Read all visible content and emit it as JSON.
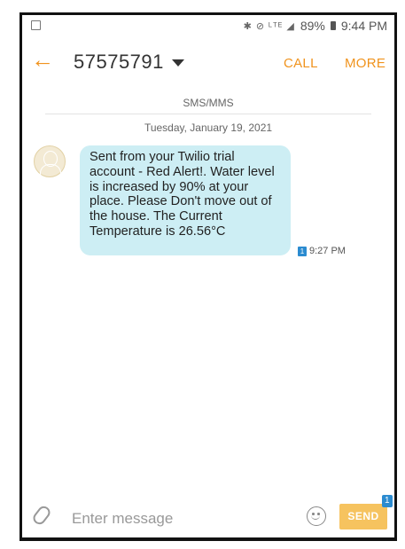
{
  "status": {
    "battery": "89%",
    "time": "9:44 PM",
    "icons": [
      "screenshot-icon",
      "bluetooth-icon",
      "mute-icon",
      "lte-icon",
      "signal-icon",
      "battery-icon"
    ]
  },
  "header": {
    "contact": "57575791",
    "call_label": "CALL",
    "more_label": "MORE",
    "accent_color": "#f0931d"
  },
  "thread": {
    "channel_label": "SMS/MMS",
    "date_label": "Tuesday, January 19, 2021",
    "messages": [
      {
        "text": "Sent from your Twilio trial account - Red Alert!. Water level is increased by 90% at your place. Please Don't move out of the house. The Current Temperature is 26.56°C",
        "sim": "1",
        "time": "9:27 PM",
        "bubble_color": "#cdeef4"
      }
    ]
  },
  "composer": {
    "placeholder": "Enter message",
    "value": "",
    "send_label": "SEND",
    "send_badge": "1"
  }
}
